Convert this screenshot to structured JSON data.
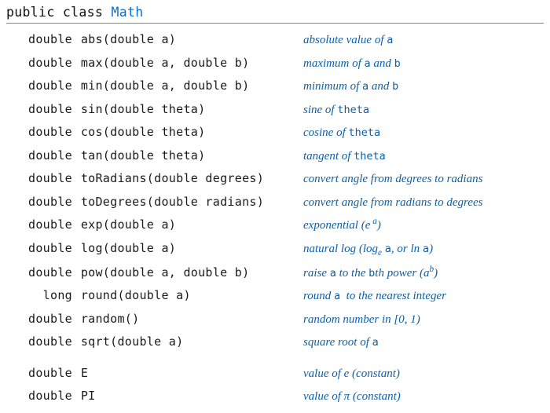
{
  "header": {
    "prefix": "public class",
    "class_name": "Math"
  },
  "methods": [
    {
      "ret": "double",
      "name": "abs",
      "params": "(double a)",
      "desc": "absolute value of <span class=\"mono\">a</span>"
    },
    {
      "ret": "double",
      "name": "max",
      "params": "(double a, double b)",
      "desc": "maximum of <span class=\"mono\">a</span> and <span class=\"mono\">b</span>"
    },
    {
      "ret": "double",
      "name": "min",
      "params": "(double a, double b)",
      "desc": "minimum of <span class=\"mono\">a</span> and <span class=\"mono\">b</span>"
    },
    {
      "ret": "double",
      "name": "sin",
      "params": "(double theta)",
      "desc": "sine of <span class=\"mono\">theta</span>"
    },
    {
      "ret": "double",
      "name": "cos",
      "params": "(double theta)",
      "desc": "cosine of <span class=\"mono\">theta</span>"
    },
    {
      "ret": "double",
      "name": "tan",
      "params": "(double theta)",
      "desc": "tangent of <span class=\"mono\">theta</span>"
    },
    {
      "ret": "double",
      "name": "toRadians",
      "params": "(double degrees)",
      "desc": "convert angle from degrees to radians"
    },
    {
      "ret": "double",
      "name": "toDegrees",
      "params": "(double radians)",
      "desc": "convert angle from radians to degrees"
    },
    {
      "ret": "double",
      "name": "exp",
      "params": "(double a)",
      "desc": "exponential (e<sup>&nbsp;a</sup>)"
    },
    {
      "ret": "double",
      "name": "log",
      "params": "(double a)",
      "desc": "natural log (log<sub>e</sub> <span class=\"mono\">a</span>, or ln <span class=\"mono\">a</span>)"
    },
    {
      "ret": "double",
      "name": "pow",
      "params": "(double a, double b)",
      "desc": "raise <span class=\"mono\">a</span> to the <span class=\"mono\">b</span>th power (a<sup>b</sup>)"
    },
    {
      "ret": "long",
      "name": "round",
      "params": "(double a)",
      "desc": "round <span class=\"mono\">a</span>&nbsp; to the nearest integer"
    },
    {
      "ret": "double",
      "name": "random",
      "params": "()",
      "desc": "random number in [0, 1)"
    },
    {
      "ret": "double",
      "name": "sqrt",
      "params": "(double a)",
      "desc": "square root of <span class=\"mono\">a</span>"
    }
  ],
  "constants": [
    {
      "ret": "double",
      "name": "E",
      "params": "",
      "desc": "value of e (constant)"
    },
    {
      "ret": "double",
      "name": "PI",
      "params": "",
      "desc": "value of &pi; (constant)"
    }
  ]
}
